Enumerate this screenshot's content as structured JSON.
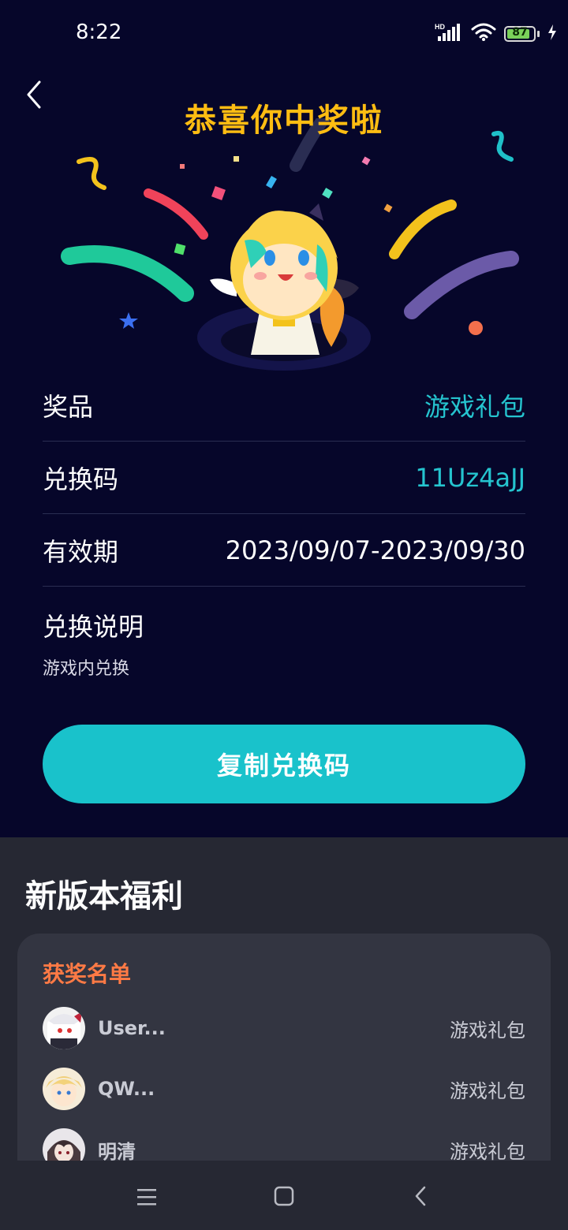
{
  "status_bar": {
    "time": "8:22",
    "battery": "87",
    "icons": [
      "hd-signal-icon",
      "wifi-icon",
      "battery-icon",
      "charging-icon"
    ]
  },
  "header": {
    "title": "恭喜你中奖啦",
    "back_icon": "chevron-left-icon"
  },
  "prize_info": {
    "rows": [
      {
        "label": "奖品",
        "value": "游戏礼包"
      },
      {
        "label": "兑换码",
        "value": "11Uz4aJJ"
      },
      {
        "label": "有效期",
        "value": "2023/09/07-2023/09/30"
      }
    ],
    "instructions_title": "兑换说明",
    "instructions_text": "游戏内兑换"
  },
  "copy_button": {
    "label": "复制兑换码"
  },
  "welfare": {
    "section_title": "新版本福利",
    "winners_title": "获奖名单",
    "winners": [
      {
        "name": "User...",
        "prize": "游戏礼包"
      },
      {
        "name": "QW...",
        "prize": "游戏礼包"
      },
      {
        "name": "明清",
        "prize": "游戏礼包"
      }
    ]
  },
  "nav_bar": {
    "icons": [
      "menu-icon",
      "home-square-icon",
      "back-triangle-icon"
    ]
  },
  "colors": {
    "background": "#06062a",
    "title": "#ffbd12",
    "accent_teal": "#19c2cb",
    "winners_title": "#ff7a45"
  }
}
